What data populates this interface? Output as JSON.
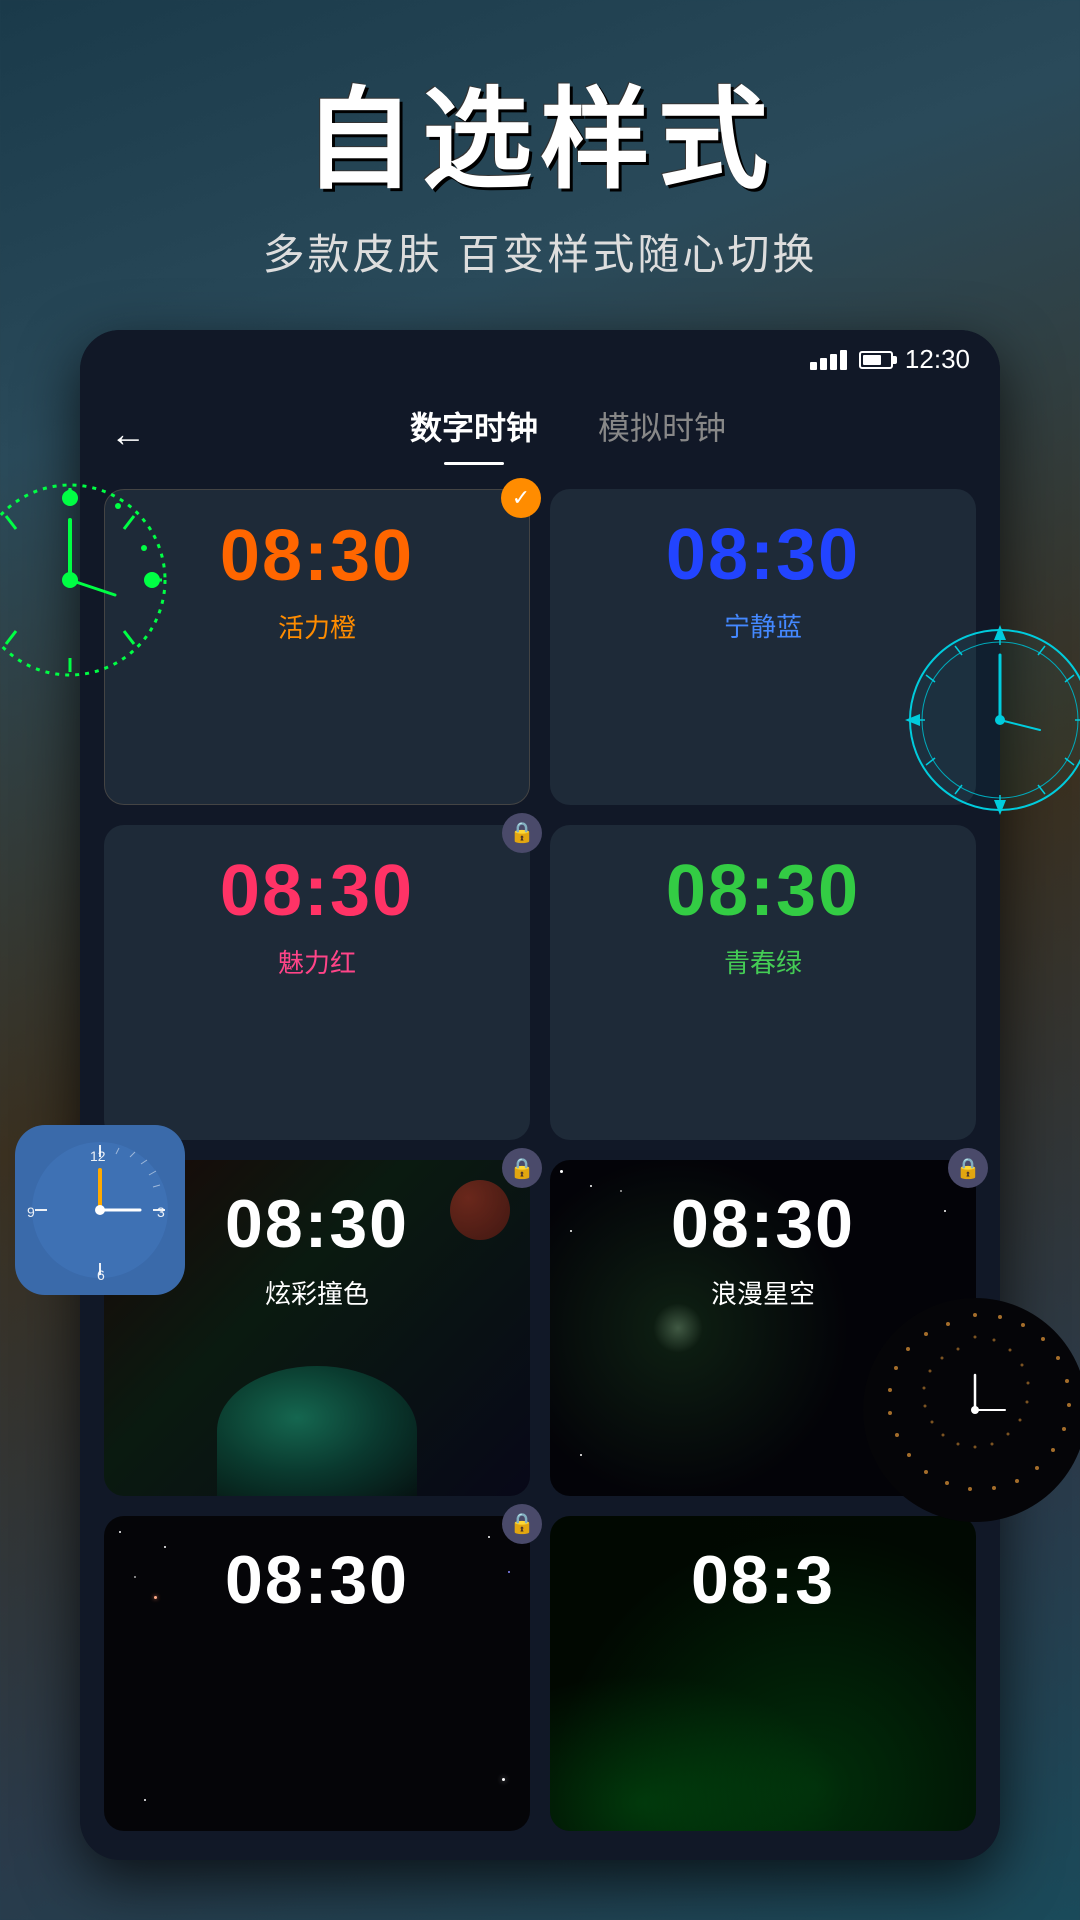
{
  "header": {
    "main_title": "自选样式",
    "subtitle": "多款皮肤 百变样式随心切换"
  },
  "status_bar": {
    "time": "12:30"
  },
  "nav": {
    "back_label": "←",
    "tab_digital": "数字时钟",
    "tab_analog": "模拟时钟"
  },
  "clock_styles": [
    {
      "id": "orange",
      "time": "08:30",
      "label": "活力橙",
      "color_class": "orange",
      "label_color": "orange",
      "selected": true,
      "locked": false,
      "bg_type": "dark"
    },
    {
      "id": "blue",
      "time": "08:30",
      "label": "宁静蓝",
      "color_class": "blue",
      "label_color": "blue",
      "selected": false,
      "locked": false,
      "bg_type": "dark"
    },
    {
      "id": "pink",
      "time": "08:30",
      "label": "魅力红",
      "color_class": "pink",
      "label_color": "pink",
      "selected": false,
      "locked": true,
      "bg_type": "dark"
    },
    {
      "id": "green",
      "time": "08:30",
      "label": "青春绿",
      "color_class": "green",
      "label_color": "green",
      "selected": false,
      "locked": false,
      "bg_type": "dark"
    },
    {
      "id": "colorful",
      "time": "08:30",
      "label": "炫彩撞色",
      "color_class": "white",
      "label_color": "white",
      "selected": false,
      "locked": true,
      "bg_type": "colorful"
    },
    {
      "id": "space",
      "time": "08:30",
      "label": "浪漫星空",
      "color_class": "white",
      "label_color": "white",
      "selected": false,
      "locked": true,
      "bg_type": "space"
    },
    {
      "id": "dark1",
      "time": "08:30",
      "label": "",
      "color_class": "white",
      "label_color": "white",
      "selected": false,
      "locked": true,
      "bg_type": "dark"
    },
    {
      "id": "neon",
      "time": "08:3",
      "label": "",
      "color_class": "white",
      "label_color": "white",
      "selected": false,
      "locked": false,
      "bg_type": "neon"
    }
  ],
  "decorative_clocks": {
    "green_analog": "visible",
    "cyan_analog": "visible",
    "blue_square": "visible",
    "spiral": "visible"
  },
  "icons": {
    "check": "✓",
    "lock": "🔒",
    "back": "←"
  }
}
